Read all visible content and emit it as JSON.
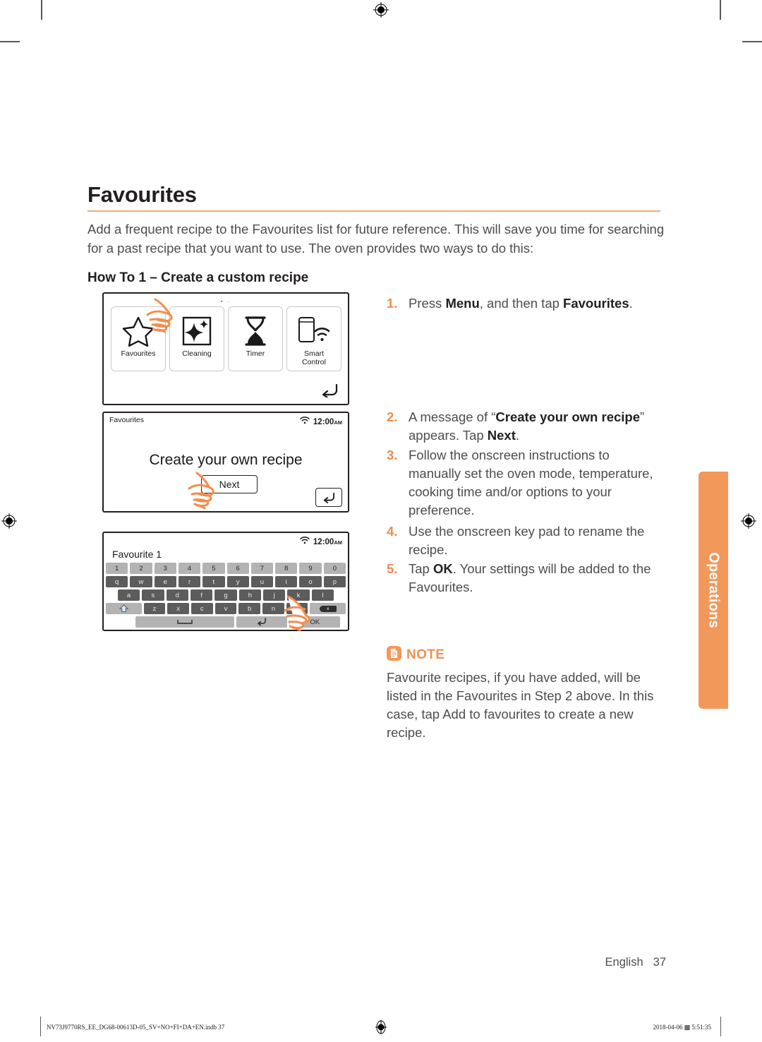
{
  "document": {
    "heading": "Favourites",
    "intro": "Add a frequent recipe to the Favourites list for future reference. This will save you time for searching for a past recipe that you want to use. The oven provides two ways to do this:",
    "subheading": "How To 1 – Create a custom recipe"
  },
  "menu_screen": {
    "pager_dots": "• ·",
    "tiles": [
      {
        "label": "Favourites",
        "icon": "star-icon"
      },
      {
        "label": "Cleaning",
        "icon": "sparkle-icon"
      },
      {
        "label": "Timer",
        "icon": "hourglass-icon"
      },
      {
        "label": "Smart\nControl",
        "label_line1": "Smart",
        "label_line2": "Control",
        "icon": "smart-control-icon"
      }
    ],
    "back_icon": "back-arrow-icon"
  },
  "create_screen": {
    "title": "Favourites",
    "wifi_icon": "wifi-icon",
    "clock": "12:00",
    "clock_ampm": "AM",
    "message": "Create your own recipe",
    "next_button": "Next",
    "back_icon": "back-arrow-icon"
  },
  "keypad_screen": {
    "wifi_icon": "wifi-icon",
    "clock": "12:00",
    "clock_ampm": "AM",
    "field_value": "Favourite 1",
    "rows": {
      "numbers": [
        "1",
        "2",
        "3",
        "4",
        "5",
        "6",
        "7",
        "8",
        "9",
        "0"
      ],
      "top": [
        "q",
        "w",
        "e",
        "r",
        "t",
        "y",
        "u",
        "i",
        "o",
        "p"
      ],
      "home": [
        "a",
        "s",
        "d",
        "f",
        "g",
        "h",
        "j",
        "k",
        "l"
      ],
      "bottom": [
        "z",
        "x",
        "c",
        "v",
        "b",
        "n",
        "m"
      ]
    },
    "shift_key": "⇧",
    "backspace_key": "x",
    "space_key": "␣",
    "return_key": "↰",
    "ok_key": "OK"
  },
  "steps": [
    {
      "num": "1.",
      "html": "Press <b>Menu</b>, and then tap <b>Favourites</b>."
    },
    {
      "num": "2.",
      "html": "A message of “<b>Create your own recipe</b>” appears. Tap <b>Next</b>."
    },
    {
      "num": "3.",
      "html": "Follow the onscreen instructions to manually set the oven mode, temperature, cooking time and/or options to your preference."
    },
    {
      "num": "4.",
      "html": "Use the onscreen key pad to rename the recipe."
    },
    {
      "num": "5.",
      "html": "Tap <b>OK</b>. Your settings will be added to the Favourites."
    }
  ],
  "note": {
    "icon": "note-document-icon",
    "title": "NOTE",
    "body": "Favourite recipes, if you have added, will be listed in the Favourites in Step 2 above. In this case, tap Add to favourites to create a new recipe."
  },
  "side_tab": {
    "label": "Operations"
  },
  "footer": {
    "language": "English",
    "page_number": "37",
    "print_left": "NV73J9770RS_EE_DG68-00613D-05_SV+NO+FI+DA+EN.indb   37",
    "print_right": "2018-04-06   ▩ 5:51:35"
  },
  "colors": {
    "accent_orange": "#f3985b",
    "rule_orange": "#f4a875",
    "step_number": "#f08b4d",
    "body_text": "#4d4d4d",
    "heading_text": "#231f20",
    "key_light": "#b3b3b3",
    "key_dark": "#5c5c5c"
  }
}
